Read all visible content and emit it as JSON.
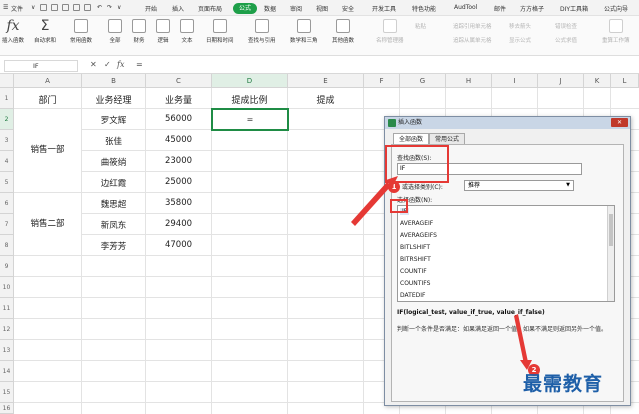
{
  "menubar": {
    "file": "文件",
    "tabs": [
      "开始",
      "插入",
      "页面布局",
      "公式",
      "数据",
      "审阅",
      "视图",
      "安全",
      "开发工具",
      "特色功能",
      "AudTool",
      "邮件",
      "方方格子",
      "DIY工具箱",
      "公式向导"
    ],
    "active_tab": "公式"
  },
  "ribbon": {
    "buttons": [
      "插入函数",
      "自动求和",
      "常用函数",
      "全部",
      "财务",
      "逻辑",
      "文本",
      "日期和时间",
      "查找与引用",
      "数学和三角",
      "其他函数"
    ],
    "disabled": [
      "名称管理器",
      "粘贴",
      "追踪引用单元格",
      "追踪从属单元格",
      "移去箭头",
      "显示公式",
      "错误检查",
      "公式求值",
      "重算工作簿"
    ]
  },
  "formula_bar": {
    "name_box": "IF",
    "cancel": "✕",
    "confirm": "✓",
    "fx": "fx",
    "content": "="
  },
  "grid": {
    "columns": [
      "A",
      "B",
      "C",
      "D",
      "E",
      "F",
      "G",
      "H",
      "I",
      "J",
      "K",
      "L"
    ],
    "rows": [
      "1",
      "2",
      "3",
      "4",
      "5",
      "6",
      "7",
      "8",
      "9",
      "10",
      "11",
      "12",
      "13",
      "14",
      "15",
      "16"
    ],
    "headers": [
      "部门",
      "业务经理",
      "业务量",
      "提成比例",
      "提成"
    ],
    "dept1": "销售一部",
    "dept2": "销售二部",
    "managers": [
      "罗文辉",
      "张佳",
      "曲筱绡",
      "边红霞",
      "魏思超",
      "新凤东",
      "李芳芳"
    ],
    "volumes": [
      "56000",
      "45000",
      "23000",
      "25000",
      "35800",
      "29400",
      "47000"
    ],
    "active_value": "="
  },
  "dialog": {
    "title": "插入函数",
    "close": "✕",
    "tabs": [
      "全部函数",
      "常用公式"
    ],
    "search_label": "查找函数(S):",
    "search_value": "IF",
    "category_label": "或选择类别(C):",
    "category_value": "推荐",
    "list_label": "选择函数(N):",
    "functions": [
      "IF",
      "AVERAGEIF",
      "AVERAGEIFS",
      "BITLSHIFT",
      "BITRSHIFT",
      "COUNTIF",
      "COUNTIFS",
      "DATEDIF"
    ],
    "signature": "IF(logical_test, value_if_true, value_if_false)",
    "description": "判断一个条件是否满足：如果满足返回一个值，如果不满足则返回另外一个值。"
  },
  "badges": [
    "1",
    "2"
  ],
  "watermark": "最需教育",
  "colors": {
    "accent": "#1e9f49",
    "annotation": "#e53935",
    "watermark": "#1e5fa8"
  }
}
